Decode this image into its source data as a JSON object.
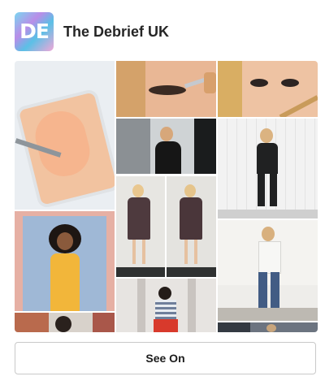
{
  "profile": {
    "avatar_text": "DE",
    "name": "The Debrief UK"
  },
  "grid": {
    "photos": [
      "ice-cream-scoop-photo",
      "eyeliner-closeup-photo",
      "blush-brush-closeup-photo",
      "woman-black-outfit-photo",
      "polka-dot-dress-front-photo",
      "polka-dot-dress-back-photo",
      "black-jumpsuit-white-wall-photo",
      "yellow-dress-pink-wall-photo",
      "white-top-jeans-photo",
      "striped-top-red-skirt-photo",
      "brick-wall-partial-photo",
      "street-partial-photo"
    ]
  },
  "button": {
    "label": "See On"
  },
  "colors": {
    "text": "#262626",
    "border": "#c9c9c9"
  }
}
